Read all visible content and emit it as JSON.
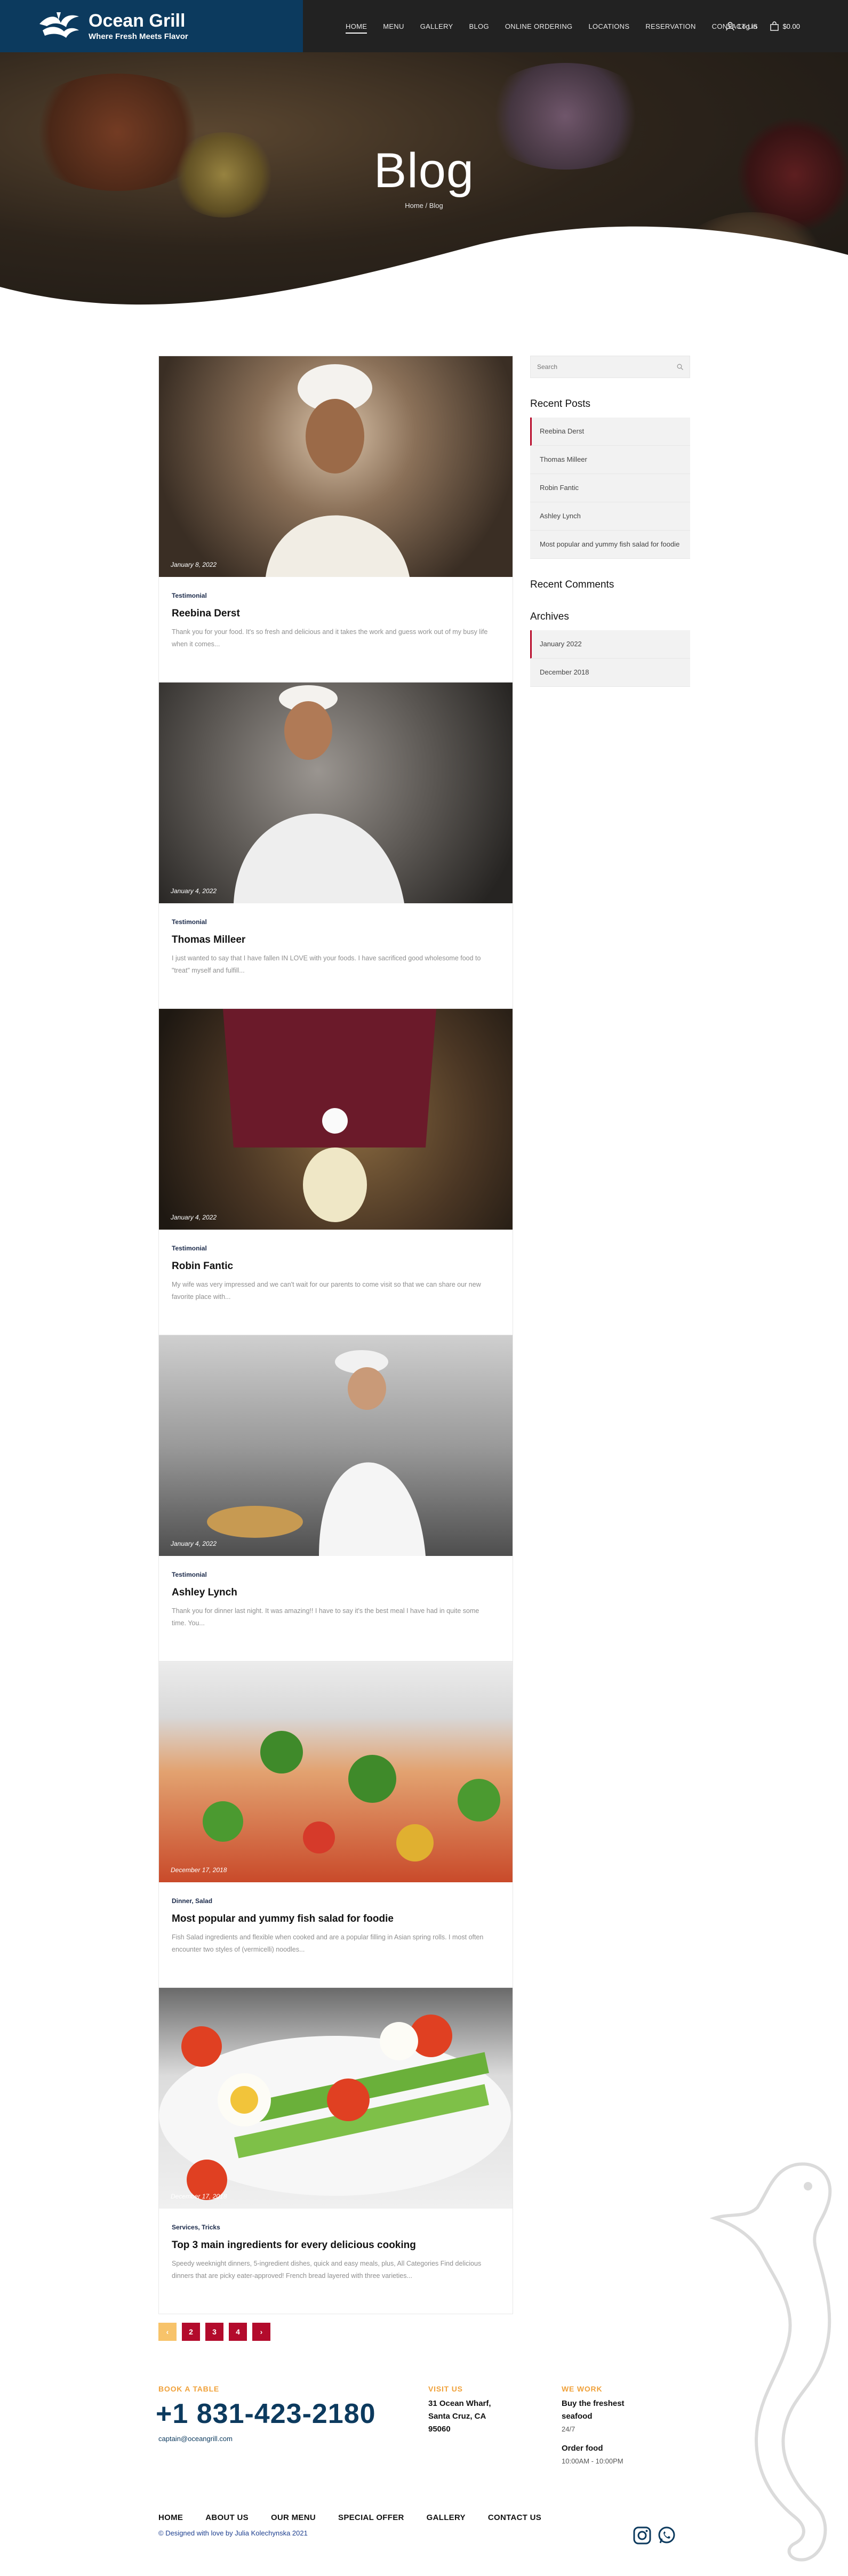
{
  "brand": {
    "name": "Ocean Grill",
    "tagline": "Where Fresh Meets Flavor"
  },
  "nav": {
    "items": [
      "HOME",
      "MENU",
      "GALLERY",
      "BLOG",
      "ONLINE ORDERING",
      "LOCATIONS",
      "RESERVATION",
      "CONTACT US"
    ],
    "login": "Log in",
    "cart": "$0.00"
  },
  "hero": {
    "title": "Blog",
    "breadcrumb": "Home / Blog"
  },
  "posts": [
    {
      "date": "January 8, 2022",
      "category": "Testimonial",
      "title": "Reebina Derst",
      "excerpt": "Thank you for your food. It's so fresh and delicious and it takes the work and guess work out of my busy life when it comes..."
    },
    {
      "date": "January 4, 2022",
      "category": "Testimonial",
      "title": "Thomas Milleer",
      "excerpt": "I just wanted to say that I have fallen IN LOVE with your foods. I have sacrificed good wholesome food to \"treat\" myself and fulfill..."
    },
    {
      "date": "January 4, 2022",
      "category": "Testimonial",
      "title": "Robin Fantic",
      "excerpt": "My wife was very impressed and we can't wait for our parents to come visit so that we can share our new favorite place with..."
    },
    {
      "date": "January 4, 2022",
      "category": "Testimonial",
      "title": "Ashley Lynch",
      "excerpt": "Thank you for dinner last night. It was amazing!! I have to say it's the best meal I have had in quite some time. You..."
    },
    {
      "date": "December 17, 2018",
      "category": "Dinner, Salad",
      "title": "Most popular and yummy fish salad for foodie",
      "excerpt": "Fish Salad ingredients and flexible when cooked and are a popular filling in Asian spring rolls. I most often encounter two styles of (vermicelli) noodles..."
    },
    {
      "date": "December 17, 2018",
      "category": "Services, Tricks",
      "title": "Top 3 main ingredients for every delicious cooking",
      "excerpt": "Speedy weeknight dinners, 5-ingredient dishes, quick and easy meals, plus, All Categories Find delicious dinners that are picky eater-approved! French bread layered with three varieties..."
    }
  ],
  "sidebar": {
    "search_placeholder": "Search",
    "recent_posts_title": "Recent Posts",
    "recent_posts": [
      "Reebina Derst",
      "Thomas Milleer",
      "Robin Fantic",
      "Ashley Lynch",
      "Most popular and yummy fish salad for foodie"
    ],
    "recent_comments_title": "Recent Comments",
    "archives_title": "Archives",
    "archives": [
      "January 2022",
      "December 2018"
    ]
  },
  "pagination": {
    "prev": "‹",
    "pages": [
      "2",
      "3",
      "4"
    ],
    "next": "›"
  },
  "footer": {
    "book_label": "BOOK A TABLE",
    "phone": "+1 831-423-2180",
    "email": "captain@oceangrill.com",
    "visit_label": "VISIT US",
    "address_1": "31 Ocean Wharf,",
    "address_2": "Santa Cruz, CA",
    "address_3": "95060",
    "work_label": "WE WORK",
    "work_1_title": "Buy the freshest",
    "work_1_title_2": "seafood",
    "work_1_hours": "24/7",
    "work_2_title": "Order food",
    "work_2_hours": "10:00AM - 10:00PM",
    "nav": [
      "HOME",
      "ABOUT US",
      "OUR MENU",
      "SPECIAL OFFER",
      "GALLERY",
      "CONTACT US"
    ],
    "credit": "© Designed with love by Julia Kolechynska 2021"
  },
  "colors": {
    "brand_navy": "#0c3a5e",
    "accent_red": "#b30b2c",
    "accent_orange": "#f0a13a"
  }
}
